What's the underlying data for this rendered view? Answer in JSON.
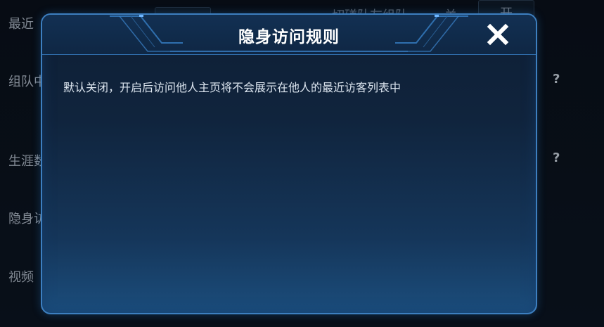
{
  "background": {
    "labels": [
      "最近",
      "组队中",
      "生涯数据",
      "隐身访问",
      "视频"
    ],
    "right_label": "切磋队友组队",
    "toggle_off": "关",
    "toggle_on": "开",
    "help": "?"
  },
  "dialog": {
    "title": "隐身访问规则",
    "body": "默认关闭，开启后访问他人主页将不会展示在他人的最近访客列表中",
    "close_icon": "close-icon"
  },
  "colors": {
    "accent": "#3d7fc0",
    "title_text": "#ffffff"
  }
}
